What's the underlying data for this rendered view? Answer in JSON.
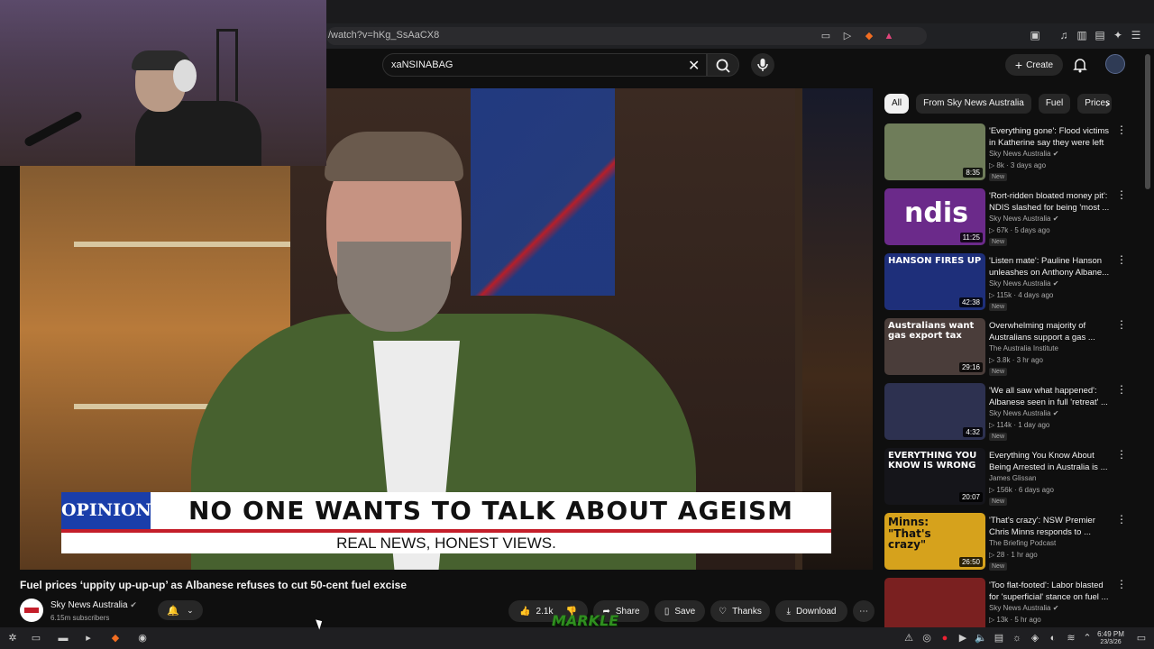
{
  "browser": {
    "url": "/watch?v=hKg_SsAaCX8"
  },
  "search": {
    "value": "xaNSINABAG"
  },
  "masthead": {
    "create_label": "Create"
  },
  "video": {
    "opinion_label": "OPINION",
    "headline": "NO ONE WANTS TO TALK ABOUT AGEISM",
    "subline": "REAL NEWS, HONEST VIEWS.",
    "title": "Fuel prices ‘uppity up-up-up’ as Albanese refuses to cut 50-cent fuel excise",
    "channel": "Sky News Australia",
    "subscribers": "6.15m subscribers",
    "likes": "2.1k",
    "share_label": "Share",
    "save_label": "Save",
    "thanks_label": "Thanks",
    "download_label": "Download",
    "watermark": "MARKLE"
  },
  "chips": [
    "All",
    "From Sky News Australia",
    "Fuel",
    "Prices"
  ],
  "recommendations": [
    {
      "title": "'Everything gone': Flood victims in Katherine say they were left ...",
      "channel": "Sky News Australia",
      "verified": true,
      "meta": "8k · 3 days ago",
      "badge": "New",
      "duration": "8:35",
      "thumb_text": "",
      "thumb_color": "#6f7d5a"
    },
    {
      "title": "'Rort-ridden bloated money pit': NDIS slashed for being 'most ...",
      "channel": "Sky News Australia",
      "verified": true,
      "meta": "67k · 5 days ago",
      "badge": "New",
      "duration": "11:25",
      "thumb_text": "ndis",
      "thumb_color": "#6b2a8a"
    },
    {
      "title": "'Listen mate': Pauline Hanson unleashes on Anthony Albane...",
      "channel": "Sky News Australia",
      "verified": true,
      "meta": "115k · 4 days ago",
      "badge": "New",
      "duration": "42:38",
      "thumb_text": "HANSON FIRES UP",
      "thumb_color": "#1e2f7a"
    },
    {
      "title": "Overwhelming majority of Australians support a gas ...",
      "channel": "The Australia Institute",
      "verified": false,
      "meta": "3.8k · 3 hr ago",
      "badge": "New",
      "duration": "29:16",
      "thumb_text": "Australians want gas export tax",
      "thumb_color": "#4a3d3a"
    },
    {
      "title": "'We all saw what happened': Albanese seen in full 'retreat' ...",
      "channel": "Sky News Australia",
      "verified": true,
      "meta": "114k · 1 day ago",
      "badge": "New",
      "duration": "4:32",
      "thumb_text": "",
      "thumb_color": "#2d3150"
    },
    {
      "title": "Everything You Know About Being Arrested in Australia is ...",
      "channel": "James Glissan",
      "verified": false,
      "meta": "156k · 6 days ago",
      "badge": "New",
      "duration": "20:07",
      "thumb_text": "EVERYTHING YOU KNOW IS WRONG",
      "thumb_color": "#15151a"
    },
    {
      "title": "'That's crazy': NSW Premier Chris Minns responds to ...",
      "channel": "The Briefing Podcast",
      "verified": false,
      "meta": "28 · 1 hr ago",
      "badge": "New",
      "duration": "26:50",
      "thumb_text": "Minns: \"That's crazy\"",
      "thumb_color": "#d6a21c"
    },
    {
      "title": "'Too flat-footed': Labor blasted for 'superficial' stance on fuel ...",
      "channel": "Sky News Australia",
      "verified": true,
      "meta": "13k · 5 hr ago",
      "badge": "",
      "duration": "",
      "thumb_text": "",
      "thumb_color": "#7a2020"
    }
  ],
  "taskbar": {
    "time": "6:49 PM",
    "date": "23/3/26"
  }
}
